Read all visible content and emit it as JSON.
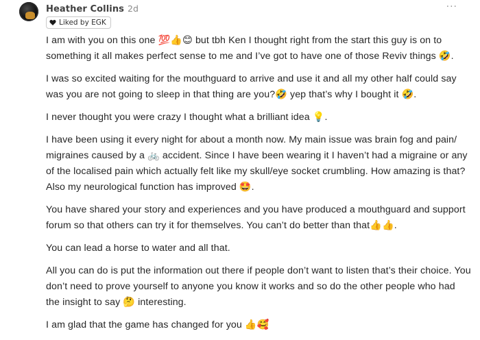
{
  "comment": {
    "author": "Heather Collins",
    "timestamp": "2d",
    "more_label": "···",
    "liked_by": "Liked by EGK",
    "paragraphs": [
      "I am with you on this one 💯👍😊 but tbh Ken I thought right from the start this guy is on to something it all makes perfect sense to me and I’ve got to have one of those Reviv things 🤣.",
      "I was so excited waiting for the mouthguard to arrive and use it and all my other half could say was you are not going to sleep in that thing are you?🤣 yep that’s why I bought it 🤣.",
      "I never thought you were crazy I thought what a brilliant idea 💡.",
      "I have been using it every night for about a month now. My main issue was brain fog and pain/ migraines caused by a 🚲 accident. Since I have been wearing it I haven’t had a migraine or any of the localised pain which actually felt like my skull/eye socket crumbling. How amazing is that? Also my neurological function has improved 🤩.",
      "You have shared your story and experiences and you have produced a mouthguard and support forum so that others can try it for themselves. You can’t do better than that👍👍.",
      "You can lead a horse to water and all that.",
      "All you can do is put the information out there if people don’t want to listen that’s their choice. You don’t need to prove yourself to anyone you know it works and so do the other people who had the insight to say 🤔 interesting.",
      "I am glad that the game has changed for you 👍🥰"
    ]
  },
  "icons": {
    "avatar": "avatar",
    "liked": "heart-icon",
    "more": "more-options-icon"
  },
  "colors": {
    "text": "#262626",
    "muted": "#8a8a8a",
    "badge_border": "#c9c9c9",
    "heart": "#1a1a1a"
  }
}
